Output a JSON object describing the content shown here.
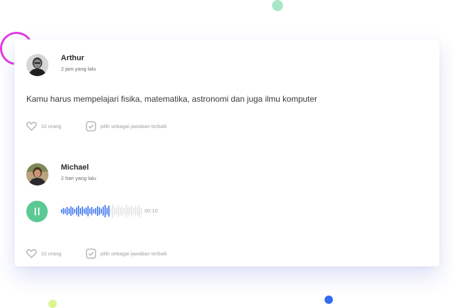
{
  "colors": {
    "accent_blue": "#2f6cf0",
    "play_green": "#5cc995",
    "wave_inactive": "#e3e3e3",
    "action_icon": "#b5b5b5"
  },
  "comments": [
    {
      "name": "Arthur",
      "time": "2 jam yang lalu",
      "message": "Kamu harus mempelajari fisika, matematika, astronomi dan juga ilmu komputer",
      "likes": "10 orang",
      "best_answer": "pilih sebagai jawaban terbaik"
    },
    {
      "name": "Michael",
      "time": "2 hari yang lalu",
      "audio": {
        "duration": "00:10",
        "progress": 0.6,
        "state": "paused"
      },
      "likes": "10 orang",
      "best_answer": "pilih sebagai jawaban terbaik"
    }
  ],
  "icons": {
    "like": "heart-icon",
    "best_answer": "checkbox-check-icon",
    "play": "pause-icon"
  }
}
